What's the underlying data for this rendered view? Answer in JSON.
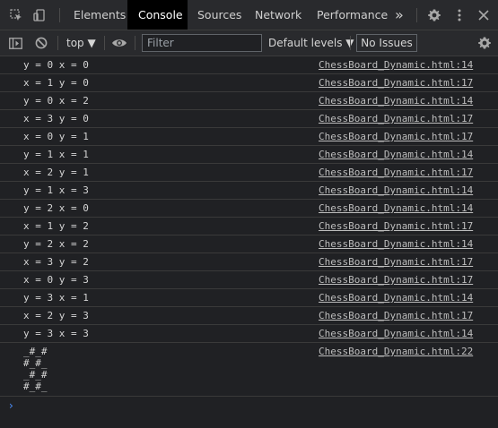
{
  "tabbar": {
    "tabs": [
      {
        "label": "Elements"
      },
      {
        "label": "Console"
      },
      {
        "label": "Sources"
      },
      {
        "label": "Network"
      },
      {
        "label": "Performance"
      }
    ],
    "active_tab": "Console",
    "more_tabs_label": "»",
    "icons": [
      "inspect-icon",
      "device-toolbar-icon",
      "more-tabs-icon",
      "settings-icon",
      "kebab-menu-icon",
      "close-icon"
    ]
  },
  "toolbar": {
    "context_label": "top ▼",
    "filter": {
      "value": "",
      "placeholder": "Filter"
    },
    "levels_label": "Default levels ▼",
    "issues_label": "No Issues",
    "icons": [
      "sidebar-toggle-icon",
      "clear-console-icon",
      "live-expression-eye-icon",
      "console-settings-icon"
    ]
  },
  "console": {
    "messages": [
      {
        "text": "y = 0 x = 0",
        "source": "ChessBoard_Dynamic.html:14"
      },
      {
        "text": "x = 1 y = 0",
        "source": "ChessBoard_Dynamic.html:17"
      },
      {
        "text": "y = 0 x = 2",
        "source": "ChessBoard_Dynamic.html:14"
      },
      {
        "text": "x = 3 y = 0",
        "source": "ChessBoard_Dynamic.html:17"
      },
      {
        "text": "x = 0 y = 1",
        "source": "ChessBoard_Dynamic.html:17"
      },
      {
        "text": "y = 1 x = 1",
        "source": "ChessBoard_Dynamic.html:14"
      },
      {
        "text": "x = 2 y = 1",
        "source": "ChessBoard_Dynamic.html:17"
      },
      {
        "text": "y = 1 x = 3",
        "source": "ChessBoard_Dynamic.html:14"
      },
      {
        "text": "y = 2 x = 0",
        "source": "ChessBoard_Dynamic.html:14"
      },
      {
        "text": "x = 1 y = 2",
        "source": "ChessBoard_Dynamic.html:17"
      },
      {
        "text": "y = 2 x = 2",
        "source": "ChessBoard_Dynamic.html:14"
      },
      {
        "text": "x = 3 y = 2",
        "source": "ChessBoard_Dynamic.html:17"
      },
      {
        "text": "x = 0 y = 3",
        "source": "ChessBoard_Dynamic.html:17"
      },
      {
        "text": "y = 3 x = 1",
        "source": "ChessBoard_Dynamic.html:14"
      },
      {
        "text": "x = 2 y = 3",
        "source": "ChessBoard_Dynamic.html:17"
      },
      {
        "text": "y = 3 x = 3",
        "source": "ChessBoard_Dynamic.html:14"
      },
      {
        "text": "_#_#\n#_#_\n_#_#\n#_#_",
        "source": "ChessBoard_Dynamic.html:22"
      }
    ],
    "prompt_symbol": "›"
  },
  "colors": {
    "background": "#202124",
    "toolbar": "#292a2d",
    "active_tab": "#000000",
    "prompt": "#4d90fe"
  }
}
